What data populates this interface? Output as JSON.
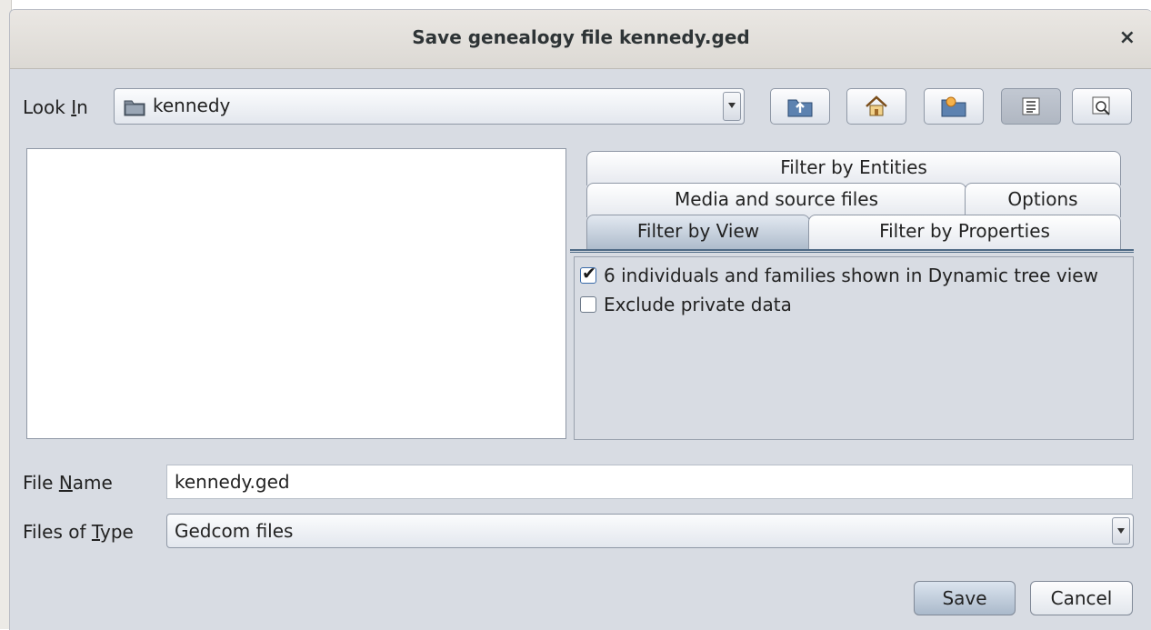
{
  "window": {
    "title": "Save genealogy file kennedy.ged",
    "close_glyph": "×"
  },
  "look_in": {
    "label_pre": "Look ",
    "label_mnemonic": "I",
    "label_post": "n",
    "value": "kennedy",
    "icon": "folder-icon"
  },
  "toolbar": {
    "buttons": [
      {
        "icon": "up-folder-icon"
      },
      {
        "icon": "home-icon"
      },
      {
        "icon": "new-folder-icon"
      },
      {
        "icon": "list-view-icon",
        "selected": true
      },
      {
        "icon": "details-view-icon"
      }
    ]
  },
  "tabs": {
    "row1": [
      "Filter by Entities"
    ],
    "row2": [
      "Media and source files",
      "Options"
    ],
    "row3": [
      "Filter by View",
      "Filter by Properties"
    ],
    "active": "Filter by View"
  },
  "filter_by_view": {
    "options": [
      {
        "label": "6 individuals and families shown in Dynamic tree view",
        "checked": true
      },
      {
        "label": "Exclude private data",
        "checked": false
      }
    ]
  },
  "file_name": {
    "label_pre": "File ",
    "label_mnemonic": "N",
    "label_post": "ame",
    "value": "kennedy.ged"
  },
  "file_type": {
    "label_pre": "Files of ",
    "label_mnemonic": "T",
    "label_post": "ype",
    "value": "Gedcom files"
  },
  "actions": {
    "save": "Save",
    "cancel": "Cancel"
  }
}
